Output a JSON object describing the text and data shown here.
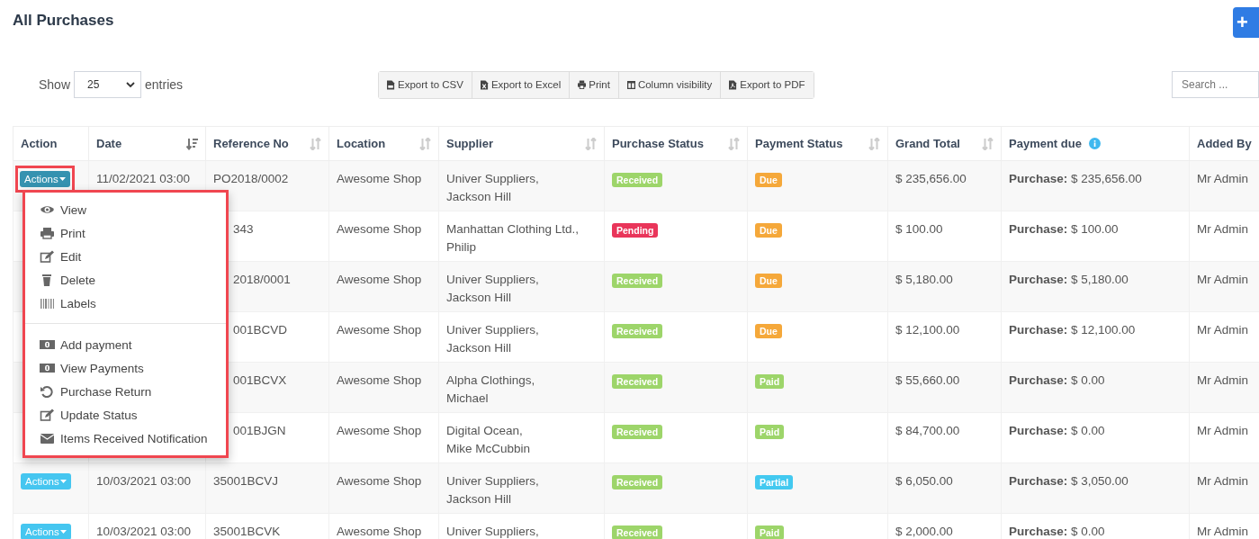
{
  "page_title": "All Purchases",
  "add_button": {
    "label": "+"
  },
  "length_menu": {
    "label": "Show",
    "value": "25",
    "suffix": "entries"
  },
  "export_buttons": [
    {
      "label": "Export to CSV"
    },
    {
      "label": "Export to Excel"
    },
    {
      "label": "Print"
    },
    {
      "label": "Column visibility"
    },
    {
      "label": "Export to PDF"
    }
  ],
  "search": {
    "placeholder": "Search ..."
  },
  "table": {
    "columns": [
      {
        "label": "Action",
        "kind": "plain"
      },
      {
        "label": "Date",
        "kind": "sorted"
      },
      {
        "label": "Reference No",
        "kind": "sortable"
      },
      {
        "label": "Location",
        "kind": "sortable"
      },
      {
        "label": "Supplier",
        "kind": "sortable"
      },
      {
        "label": "Purchase Status",
        "kind": "sortable"
      },
      {
        "label": "Payment Status",
        "kind": "sortable"
      },
      {
        "label": "Grand Total",
        "kind": "sortable"
      },
      {
        "label": "Payment due",
        "kind": "info"
      },
      {
        "label": "Added By",
        "kind": "plain"
      }
    ],
    "rows": [
      {
        "action": {
          "label": "Actions",
          "expanded": true
        },
        "date": "11/02/2021 03:00",
        "reference": "PO2018/0002",
        "location": "Awesome Shop",
        "supplier": [
          "Univer Suppliers,",
          "Jackson Hill"
        ],
        "purchase_status": {
          "label": "Received",
          "kind": "received"
        },
        "payment_status": {
          "label": "Due",
          "kind": "due"
        },
        "grand_total": "$ 235,656.00",
        "payment_due": "**Purchase:** $ 235,656.00",
        "added_by": "Mr Admin"
      },
      {
        "reference": "343",
        "location": "Awesome Shop",
        "supplier": [
          "Manhattan Clothing Ltd.,",
          "Philip"
        ],
        "purchase_status": {
          "label": "Pending",
          "kind": "pending"
        },
        "payment_status": {
          "label": "Due",
          "kind": "due"
        },
        "grand_total": "$ 100.00",
        "payment_due": "**Purchase:** $ 100.00",
        "added_by": "Mr Admin"
      },
      {
        "reference": "2018/0001",
        "location": "Awesome Shop",
        "supplier": [
          "Univer Suppliers,",
          "Jackson Hill"
        ],
        "purchase_status": {
          "label": "Received",
          "kind": "received"
        },
        "payment_status": {
          "label": "Due",
          "kind": "due"
        },
        "grand_total": "$ 5,180.00",
        "payment_due": "**Purchase:** $ 5,180.00",
        "added_by": "Mr Admin"
      },
      {
        "reference": "001BCVD",
        "location": "Awesome Shop",
        "supplier": [
          "Univer Suppliers,",
          "Jackson Hill"
        ],
        "purchase_status": {
          "label": "Received",
          "kind": "received"
        },
        "payment_status": {
          "label": "Due",
          "kind": "due"
        },
        "grand_total": "$ 12,100.00",
        "payment_due": "**Purchase:** $ 12,100.00",
        "added_by": "Mr Admin"
      },
      {
        "reference": "001BCVX",
        "location": "Awesome Shop",
        "supplier": [
          "Alpha Clothings,",
          "Michael"
        ],
        "purchase_status": {
          "label": "Received",
          "kind": "received"
        },
        "payment_status": {
          "label": "Paid",
          "kind": "paid"
        },
        "grand_total": "$ 55,660.00",
        "payment_due": "**Purchase:** $ 0.00",
        "added_by": "Mr Admin"
      },
      {
        "reference": "001BJGN",
        "location": "Awesome Shop",
        "supplier": [
          "Digital Ocean,",
          "Mike McCubbin"
        ],
        "purchase_status": {
          "label": "Received",
          "kind": "received"
        },
        "payment_status": {
          "label": "Paid",
          "kind": "paid"
        },
        "grand_total": "$ 84,700.00",
        "payment_due": "**Purchase:** $ 0.00",
        "added_by": "Mr Admin"
      },
      {
        "action": {
          "label": "Actions",
          "expanded": false
        },
        "date": "10/03/2021 03:00",
        "reference": "35001BCVJ",
        "location": "Awesome Shop",
        "supplier": [
          "Univer Suppliers,",
          "Jackson Hill"
        ],
        "purchase_status": {
          "label": "Received",
          "kind": "received"
        },
        "payment_status": {
          "label": "Partial",
          "kind": "partial"
        },
        "grand_total": "$ 6,050.00",
        "payment_due": "**Purchase:** $ 3,050.00",
        "added_by": "Mr Admin"
      },
      {
        "action": {
          "label": "Actions",
          "expanded": false
        },
        "date": "10/03/2021 03:00",
        "reference": "35001BCVK",
        "location": "Awesome Shop",
        "supplier": [
          "Univer Suppliers,"
        ],
        "purchase_status": {
          "label": "Received",
          "kind": "received"
        },
        "payment_status": {
          "label": "Paid",
          "kind": "paid"
        },
        "grand_total": "$ 2,000.00",
        "payment_due": "**Purchase:** $ 0.00",
        "added_by": "Mr Admin"
      }
    ]
  },
  "action_menu": {
    "groups": [
      [
        {
          "label": "View"
        },
        {
          "label": "Print"
        },
        {
          "label": "Edit"
        },
        {
          "label": "Delete"
        },
        {
          "label": "Labels"
        }
      ],
      [
        {
          "label": "Add payment"
        },
        {
          "label": "View Payments"
        },
        {
          "label": "Purchase Return"
        },
        {
          "label": "Update Status"
        },
        {
          "label": "Items Received Notification"
        }
      ]
    ]
  }
}
